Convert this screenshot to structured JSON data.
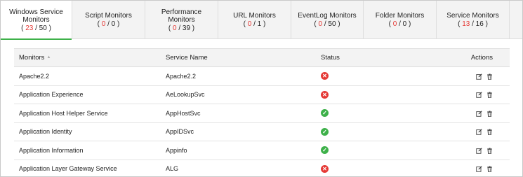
{
  "tabs": [
    {
      "label": "Windows Service Monitors",
      "count": "23",
      "total": "50"
    },
    {
      "label": "Script Monitors",
      "count": "0",
      "total": "0"
    },
    {
      "label": "Performance Monitors",
      "count": "0",
      "total": "39"
    },
    {
      "label": "URL Monitors",
      "count": "0",
      "total": "1"
    },
    {
      "label": "EventLog Monitors",
      "count": "0",
      "total": "50"
    },
    {
      "label": "Folder Monitors",
      "count": "0",
      "total": "0"
    },
    {
      "label": "Service Monitors",
      "count": "13",
      "total": "16"
    }
  ],
  "table": {
    "headers": {
      "monitors": "Monitors",
      "service_name": "Service Name",
      "status": "Status",
      "actions": "Actions"
    },
    "rows": [
      {
        "monitor": "Apache2.2",
        "service": "Apache2.2",
        "status": "down"
      },
      {
        "monitor": "Application Experience",
        "service": "AeLookupSvc",
        "status": "down"
      },
      {
        "monitor": "Application Host Helper Service",
        "service": "AppHostSvc",
        "status": "up"
      },
      {
        "monitor": "Application Identity",
        "service": "AppIDSvc",
        "status": "up"
      },
      {
        "monitor": "Application Information",
        "service": "Appinfo",
        "status": "up"
      },
      {
        "monitor": "Application Layer Gateway Service",
        "service": "ALG",
        "status": "down"
      }
    ]
  },
  "colors": {
    "accent": "#3eb14a",
    "down": "#e53935",
    "up": "#3eb14a"
  },
  "icons": {
    "edit": "edit-icon",
    "delete": "trash-icon",
    "down": "x-circle-icon",
    "up": "check-circle-icon"
  }
}
